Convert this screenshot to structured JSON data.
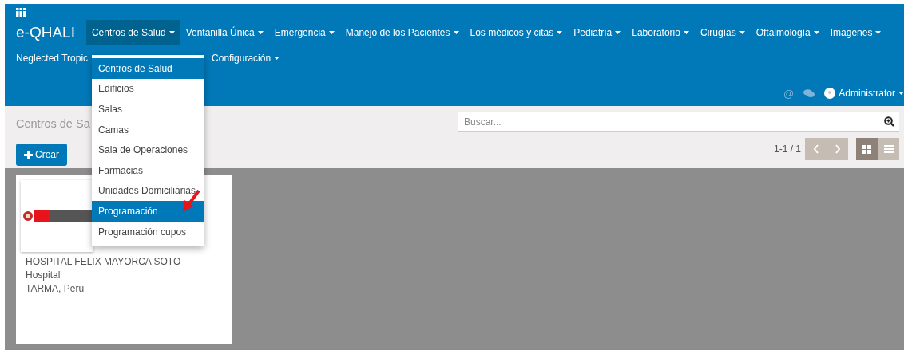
{
  "brand": "e-QHALI",
  "menu_row_1": [
    {
      "label": "Centros de Salud",
      "open": true
    },
    {
      "label": "Ventanilla Única",
      "open": false
    },
    {
      "label": "Emergencia",
      "open": false
    },
    {
      "label": "Manejo de los Pacientes",
      "open": false
    },
    {
      "label": "Los médicos y citas",
      "open": false
    },
    {
      "label": "Pediatría",
      "open": false
    },
    {
      "label": "Laboratorio",
      "open": false
    },
    {
      "label": "Cirugías",
      "open": false
    },
    {
      "label": "Oftalmología",
      "open": false
    },
    {
      "label": "Imagenes",
      "open": false
    }
  ],
  "menu_row_2": [
    {
      "label": "Neglected Tropic",
      "kind": "covered"
    },
    {
      "label": "Configuración",
      "kind": "plain"
    }
  ],
  "dropdown": [
    {
      "label": "Centros de Salud",
      "selected": true
    },
    {
      "label": "Edificios",
      "selected": false
    },
    {
      "label": "Salas",
      "selected": false
    },
    {
      "label": "Camas",
      "selected": false
    },
    {
      "label": "Sala de Operaciones",
      "selected": false
    },
    {
      "label": "Farmacias",
      "selected": false
    },
    {
      "label": "Unidades Domiciliarias",
      "selected": false
    },
    {
      "label": "Programación",
      "selected": true
    },
    {
      "label": "Programación cupos",
      "selected": false
    }
  ],
  "user": {
    "mention": "@",
    "name": "Administrator"
  },
  "breadcrumb": "Centros de Sa",
  "search": {
    "placeholder": "Buscar..."
  },
  "create_button": "Crear",
  "pager": "1-1 / 1",
  "view": {
    "kanban_selected": true
  },
  "cards": [
    {
      "lines": [
        "HOSPITAL FELIX MAYORCA SOTO",
        "Hospital",
        "TARMA, Perú"
      ]
    }
  ]
}
